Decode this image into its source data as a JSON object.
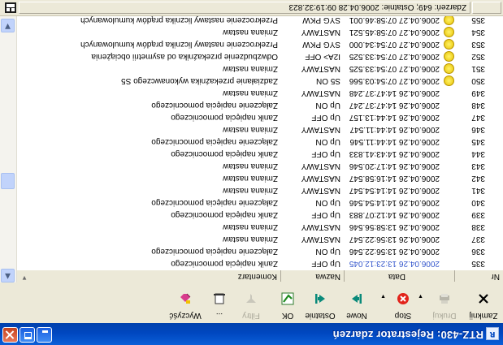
{
  "window": {
    "title": "RTZ-430: Rejestrator zdarzeń"
  },
  "toolbar": {
    "items": [
      {
        "label": "Zamknij",
        "icon": "close-x-icon",
        "enabled": true
      },
      {
        "label": "Drukuj",
        "icon": "printer-icon",
        "enabled": false
      },
      {
        "label": "Stop",
        "icon": "stop-icon",
        "enabled": true
      },
      {
        "label": "Nowe",
        "icon": "arrow-left-icon",
        "enabled": true
      },
      {
        "label": "Ostatnie",
        "icon": "arrow-right-icon",
        "enabled": true
      },
      {
        "label": "OK",
        "icon": "ok-check-icon",
        "enabled": true
      },
      {
        "label": "Filtry",
        "icon": "filter-icon",
        "enabled": false
      },
      {
        "label": "...",
        "icon": "document-icon",
        "enabled": true
      },
      {
        "label": "Wyczyść",
        "icon": "eraser-icon",
        "enabled": true
      }
    ]
  },
  "columns": {
    "nr": "Nr",
    "data": "Data",
    "nazwa": "Nazwa",
    "komentarz": "Komentarz"
  },
  "rows": [
    {
      "nr": "335",
      "data": "2006.04.26 13:23:12.045",
      "nazwa": "Up OFF",
      "komentarz": "Zanik napięcia pomocniczego",
      "warn": false,
      "highlight": true
    },
    {
      "nr": "336",
      "data": "2006.04.26 13:56:22.546",
      "nazwa": "Up ON",
      "komentarz": "Załączenie napięcia pomocniczego",
      "warn": false
    },
    {
      "nr": "337",
      "data": "2006.04.26 13:56:22.547",
      "nazwa": "NASTAWY",
      "komentarz": "Zmiana nastaw",
      "warn": false
    },
    {
      "nr": "338",
      "data": "2006.04.26 13:58:56.546",
      "nazwa": "NASTAWY",
      "komentarz": "Zmiana nastaw",
      "warn": false
    },
    {
      "nr": "339",
      "data": "2006.04.26 14:12:07.883",
      "nazwa": "Up OFF",
      "komentarz": "Zanik napięcia pomocniczego",
      "warn": false
    },
    {
      "nr": "340",
      "data": "2006.04.26 14:14:54.546",
      "nazwa": "Up ON",
      "komentarz": "Załączenie napięcia pomocniczego",
      "warn": false
    },
    {
      "nr": "341",
      "data": "2006.04.26 14:14:54.547",
      "nazwa": "NASTAWY",
      "komentarz": "Zmiana nastaw",
      "warn": false
    },
    {
      "nr": "342",
      "data": "2006.04.26 14:16:58.547",
      "nazwa": "NASTAWY",
      "komentarz": "Zmiana nastaw",
      "warn": false
    },
    {
      "nr": "343",
      "data": "2006.04.26 14:17:20.546",
      "nazwa": "NASTAWY",
      "komentarz": "Zmiana nastaw",
      "warn": false
    },
    {
      "nr": "344",
      "data": "2006.04.26 14:43:41.833",
      "nazwa": "Up OFF",
      "komentarz": "Zanik napięcia pomocniczego",
      "warn": false
    },
    {
      "nr": "345",
      "data": "2006.04.26 14:44:11.546",
      "nazwa": "Up ON",
      "komentarz": "Załączenie napięcia pomocniczego",
      "warn": false
    },
    {
      "nr": "346",
      "data": "2006.04.26 14:44:11.547",
      "nazwa": "NASTAWY",
      "komentarz": "Zmiana nastaw",
      "warn": false
    },
    {
      "nr": "347",
      "data": "2006.04.26 14:44:13.157",
      "nazwa": "Up OFF",
      "komentarz": "Zanik napięcia pomocniczego",
      "warn": false
    },
    {
      "nr": "348",
      "data": "2006.04.26 14:47:37.247",
      "nazwa": "Up ON",
      "komentarz": "Załączenie napięcia pomocniczego",
      "warn": false
    },
    {
      "nr": "349",
      "data": "2006.04.26 14:47:37.248",
      "nazwa": "NASTAWY",
      "komentarz": "Zmiana nastaw",
      "warn": false
    },
    {
      "nr": "350",
      "data": "2006.04.27 07:54:03.566",
      "nazwa": "S5 ON",
      "komentarz": "Zadziałanie przekaźnika wykonawczego S5",
      "warn": true
    },
    {
      "nr": "351",
      "data": "2006.04.27 07:54:33.525",
      "nazwa": "NASTAWY",
      "komentarz": "Zmiana nastaw",
      "warn": true
    },
    {
      "nr": "352",
      "data": "2006.04.27 07:54:33.525",
      "nazwa": "I2A> OFF",
      "komentarz": "Odwzbudzenie przekaźnika od asymetrii obciążenia",
      "warn": true
    },
    {
      "nr": "353",
      "data": "2006.04.27 07:54:34.000",
      "nazwa": "SYG PKW",
      "komentarz": "Przekroczenie nastawy licznika prądów kumulowanych",
      "warn": true
    },
    {
      "nr": "354",
      "data": "2006.04.27 07:58:45.521",
      "nazwa": "NASTAWY",
      "komentarz": "Zmiana nastaw",
      "warn": true
    },
    {
      "nr": "355",
      "data": "2006.04.27 07:58:46.001",
      "nazwa": "SYG PKW",
      "komentarz": "Przekroczenie nastawy licznika prądów kumulowanych",
      "warn": true
    }
  ],
  "status": {
    "text": "Zdarzeń: 649; Ostatnie: 2006.04.28 09:19:32.823"
  }
}
